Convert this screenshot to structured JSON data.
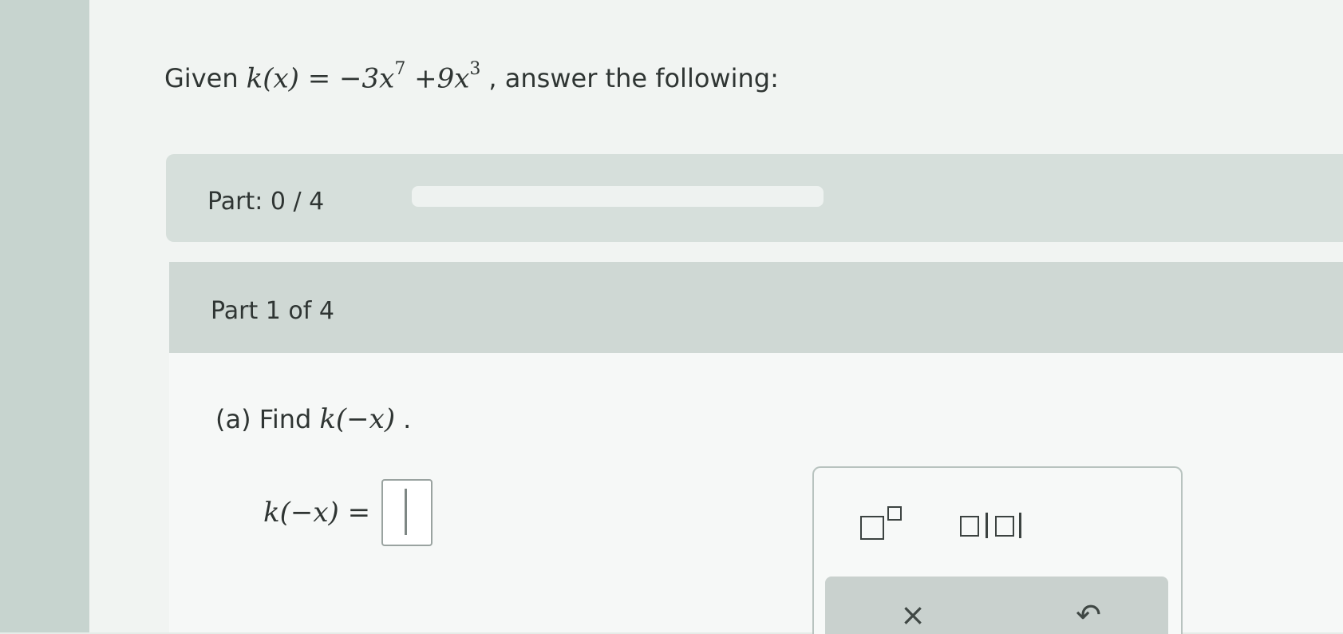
{
  "question": {
    "prefix": "Given",
    "function_lhs": "k(x) = ",
    "term1": "−3x",
    "term1_exp": "7",
    "term2": " +9x",
    "term2_exp": "3",
    "suffix": ", answer the following:"
  },
  "progress": {
    "label": "Part: 0 / 4",
    "completed": 0,
    "total": 4
  },
  "part": {
    "title": "Part 1 of 4",
    "prompt_prefix": "(a) Find",
    "prompt_math": "k(−x)",
    "prompt_suffix": ".",
    "answer_lhs": "k(−x) ="
  },
  "answer": {
    "value": ""
  },
  "keypad": {
    "superscript_icon": "superscript-template-icon",
    "absolute_value_icon": "absolute-value-template-icon",
    "clear_label": "×",
    "undo_label": "↶",
    "accent_color": "#2f7fbd"
  }
}
